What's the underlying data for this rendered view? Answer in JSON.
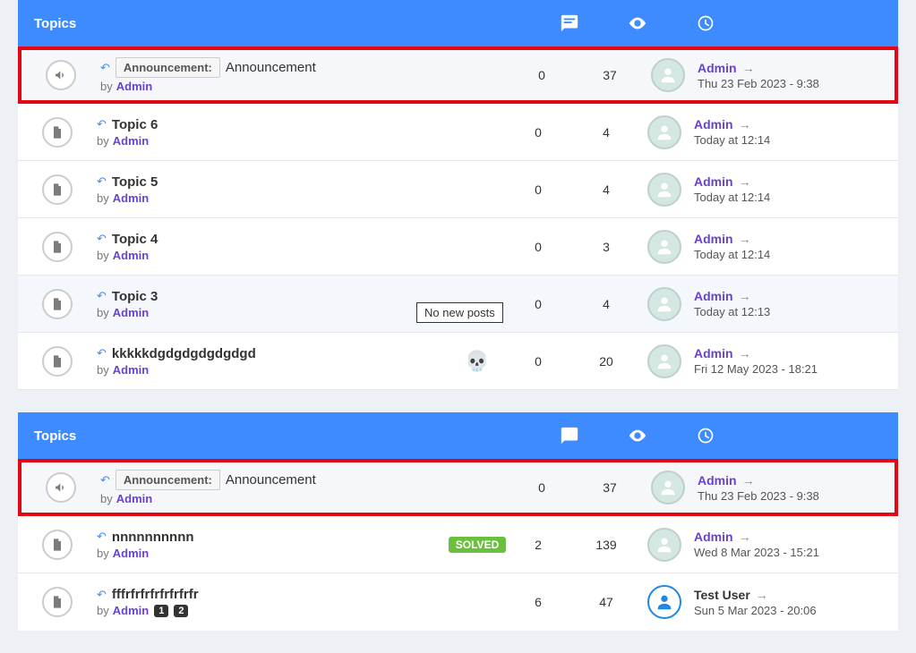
{
  "header": {
    "topics_label": "Topics"
  },
  "badges": {
    "solved": "SOLVED",
    "announcement": "Announcement:"
  },
  "tooltip": {
    "no_new_posts": "No new posts"
  },
  "section1": {
    "rows": [
      {
        "icon": "megaphone",
        "announcement": true,
        "title": "Announcement",
        "by": "by",
        "author": "Admin",
        "replies": "0",
        "views": "37",
        "last_author": "Admin",
        "last_date": "Thu 23 Feb 2023 - 9:38",
        "highlight": true
      },
      {
        "icon": "doc",
        "title": "Topic 6",
        "by": "by",
        "author": "Admin",
        "replies": "0",
        "views": "4",
        "last_author": "Admin",
        "last_date": "Today at 12:14"
      },
      {
        "icon": "doc",
        "title": "Topic 5",
        "by": "by",
        "author": "Admin",
        "replies": "0",
        "views": "4",
        "last_author": "Admin",
        "last_date": "Today at 12:14"
      },
      {
        "icon": "doc",
        "title": "Topic 4",
        "by": "by",
        "author": "Admin",
        "replies": "0",
        "views": "3",
        "last_author": "Admin",
        "last_date": "Today at 12:14"
      },
      {
        "icon": "doc",
        "title": "Topic 3",
        "by": "by",
        "author": "Admin",
        "replies": "0",
        "views": "4",
        "last_author": "Admin",
        "last_date": "Today at 12:13",
        "tooltip": true,
        "shaded": true
      },
      {
        "icon": "doc",
        "title": "kkkkkdgdgdgdgdgdgd",
        "by": "by",
        "author": "Admin",
        "replies": "0",
        "views": "20",
        "last_author": "Admin",
        "last_date": "Fri 12 May 2023 - 18:21",
        "skull": true
      }
    ]
  },
  "section2": {
    "rows": [
      {
        "icon": "megaphone",
        "announcement": true,
        "title": "Announcement",
        "by": "by",
        "author": "Admin",
        "replies": "0",
        "views": "37",
        "last_author": "Admin",
        "last_date": "Thu 23 Feb 2023 - 9:38",
        "highlight": true
      },
      {
        "icon": "doc",
        "title": "nnnnnnnnnn",
        "by": "by",
        "author": "Admin",
        "replies": "2",
        "views": "139",
        "last_author": "Admin",
        "last_date": "Wed 8 Mar 2023 - 15:21",
        "solved": true
      },
      {
        "icon": "doc",
        "title": "fffrfrfrfrfrfrfrfr",
        "by": "by",
        "author": "Admin",
        "replies": "6",
        "views": "47",
        "last_author": "Test User",
        "last_date": "Sun 5 Mar 2023 - 20:06",
        "pages": [
          "1",
          "2"
        ],
        "blue_avatar": true,
        "last_author_black": true
      }
    ]
  }
}
